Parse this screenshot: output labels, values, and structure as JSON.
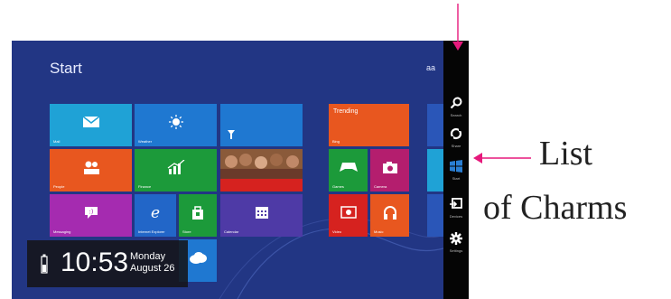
{
  "screen": {
    "title": "Start",
    "user": "aa",
    "tiles": {
      "mail": {
        "label": "Mail",
        "icon": "envelope-icon"
      },
      "weather": {
        "label": "Weather",
        "icon": "sun-icon"
      },
      "people": {
        "label": "People",
        "icon": "people-icon"
      },
      "finance": {
        "label": "Finance",
        "icon": "chart-icon"
      },
      "messaging": {
        "label": "Messaging",
        "icon": "chat-icon"
      },
      "ie": {
        "label": "Internet Explorer",
        "icon": "ie-icon"
      },
      "store": {
        "label": "Store",
        "icon": "store-bag-icon"
      },
      "calendar": {
        "label": "Calendar",
        "icon": "calendar-icon"
      },
      "news": {
        "label": "Trending"
      },
      "bing": {
        "label": "Bing"
      },
      "games": {
        "label": "Games",
        "icon": "gamepad-icon"
      },
      "camera": {
        "label": "Camera",
        "icon": "camera-icon"
      },
      "video": {
        "label": "Video",
        "icon": "play-icon"
      },
      "music": {
        "label": "Music",
        "icon": "headphones-icon"
      },
      "skydrive": {
        "icon": "cloud-icon"
      },
      "travel": {
        "icon": "pin-icon"
      },
      "photos": {
        "icon": "photo-icon"
      }
    },
    "lock": {
      "time": "10:53",
      "day": "Monday",
      "date": "August 26"
    },
    "charms": [
      {
        "label": "Search",
        "icon": "search-icon"
      },
      {
        "label": "Share",
        "icon": "share-icon"
      },
      {
        "label": "Start",
        "icon": "windows-icon"
      },
      {
        "label": "Devices",
        "icon": "devices-icon"
      },
      {
        "label": "Settings",
        "icon": "gear-icon"
      }
    ]
  },
  "annotation": {
    "line1": "List",
    "line2": "of Charms",
    "color": "#e6197c"
  },
  "colors": {
    "background": "#223684",
    "mail": "#1fa2d6",
    "weather": "#1f78d1",
    "people": "#e8571f",
    "finance": "#1c9a3a",
    "messaging": "#a52bb0",
    "ie": "#2266c8",
    "store": "#1c9a3a",
    "calendar": "#4e3aa6",
    "news": "#e8571f",
    "red": "#d6221f",
    "games": "#1c9a3a",
    "camera": "#b41e6e",
    "skydrive": "#1f78d1",
    "charms": "#050505"
  }
}
